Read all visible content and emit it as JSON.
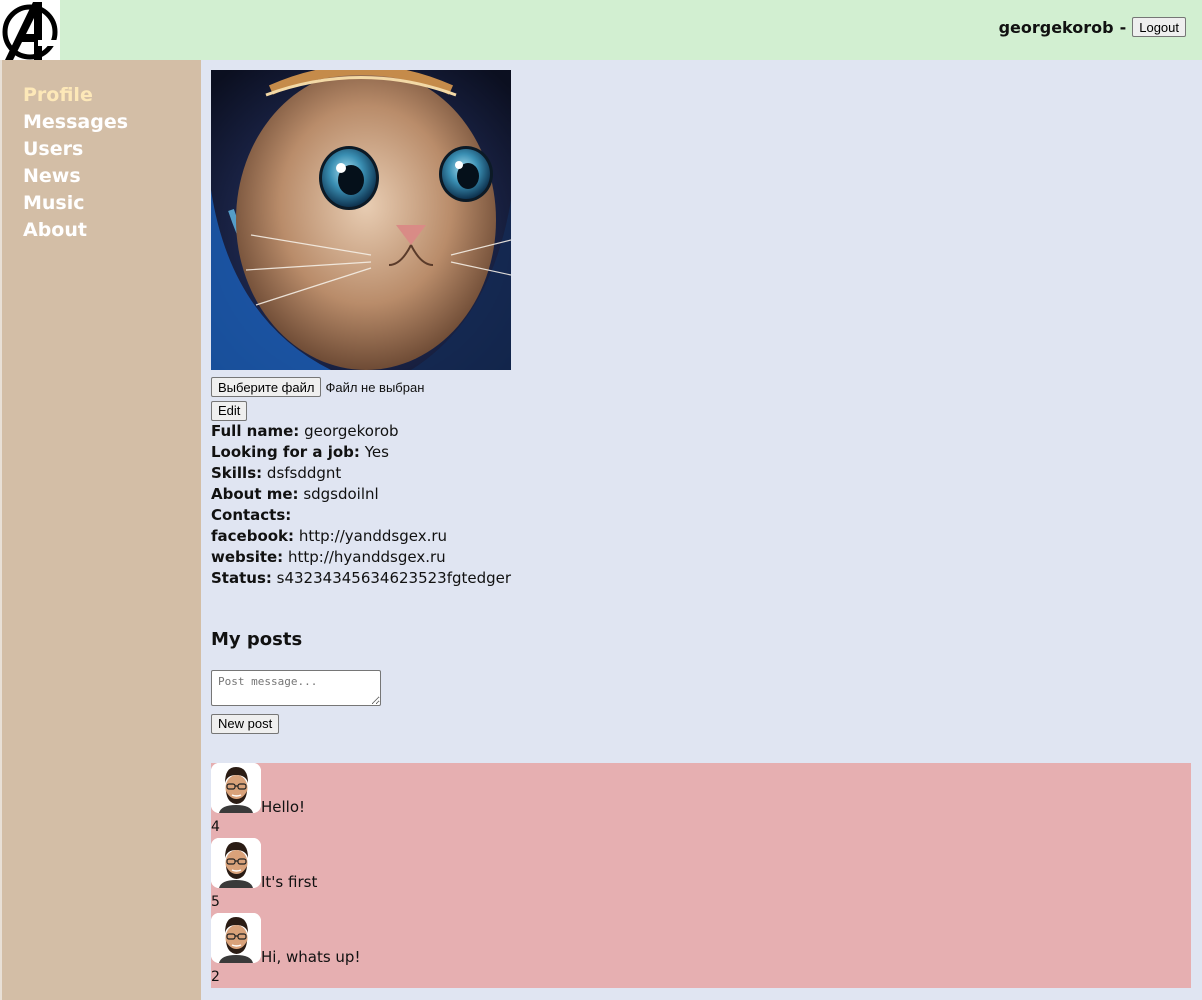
{
  "header": {
    "username": "georgekorob",
    "separator": "-",
    "logout_label": "Logout"
  },
  "nav": {
    "items": [
      {
        "label": "Profile",
        "active": true
      },
      {
        "label": "Messages"
      },
      {
        "label": "Users"
      },
      {
        "label": "News"
      },
      {
        "label": "Music"
      },
      {
        "label": "About"
      }
    ]
  },
  "profile": {
    "file_button_label": "Выберите файл",
    "file_status": "Файл не выбран",
    "edit_label": "Edit",
    "fields": [
      {
        "label": "Full name:",
        "value": "georgekorob"
      },
      {
        "label": "Looking for a job:",
        "value": "Yes"
      },
      {
        "label": "Skills:",
        "value": "dsfsddgnt"
      },
      {
        "label": "About me:",
        "value": "sdgsdoilnl"
      },
      {
        "label": "Contacts:",
        "value": ""
      },
      {
        "label": "facebook:",
        "value": "http://yanddsgex.ru"
      },
      {
        "label": "website:",
        "value": "http://hyanddsgex.ru"
      },
      {
        "label": "Status:",
        "value": "s43234345634623523fgtedger"
      }
    ]
  },
  "posts": {
    "title": "My posts",
    "placeholder": "Post message...",
    "new_post_label": "New post",
    "items": [
      {
        "message": "Hello!",
        "likes": "4"
      },
      {
        "message": "It's first",
        "likes": "5"
      },
      {
        "message": "Hi, whats up!",
        "likes": "2"
      }
    ]
  }
}
